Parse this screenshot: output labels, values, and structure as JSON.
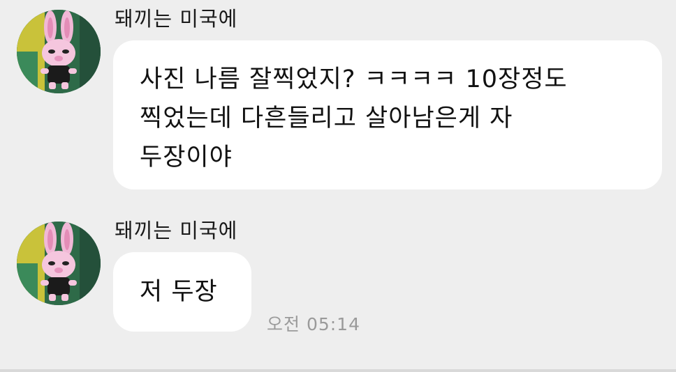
{
  "messages": [
    {
      "sender": "돼끼는 미국에",
      "avatar_icon": "plush-bunny-avatar-icon",
      "text": "사진 나름 잘찍었지? ㅋㅋㅋㅋ 10장정도\n찍었는데 다흔들리고 살아남은게 자\n두장이야"
    },
    {
      "sender": "돼끼는 미국에",
      "avatar_icon": "plush-bunny-avatar-icon",
      "text": "저 두장",
      "time": "오전 05:14"
    }
  ],
  "colors": {
    "background": "#eeeeee",
    "bubble": "#ffffff",
    "time": "#9a9a9a"
  }
}
